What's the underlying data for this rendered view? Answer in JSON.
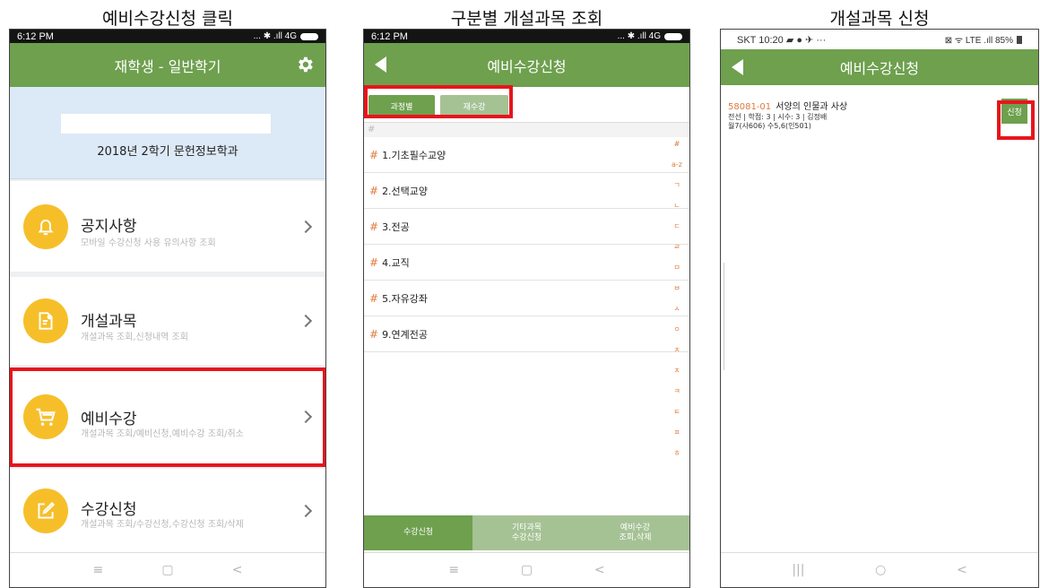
{
  "captions": [
    "예비수강신청 클릭",
    "구분별 개설과목 조회",
    "개설과목 신청"
  ],
  "phone1": {
    "status_time": "6:12 PM",
    "status_icons": "... ✱ .ıll 4G",
    "title": "재학생 - 일반학기",
    "semester": "2018년 2학기  문헌정보학과",
    "menu": [
      {
        "title": "공지사항",
        "subtitle": "모바일 수강신청 사용 유의사항 조회"
      },
      {
        "title": "개설과목",
        "subtitle": "개설과목 조회,신청내역 조회"
      },
      {
        "title": "예비수강",
        "subtitle": "개설과목 조회/예비신청,예비수강 조회/취소"
      },
      {
        "title": "수강신청",
        "subtitle": "개설과목 조회/수강신청,수강신청 조회/삭제"
      }
    ],
    "nav": [
      "≡",
      "▢",
      "<"
    ]
  },
  "phone2": {
    "status_time": "6:12 PM",
    "status_icons": "... ✱ .ıll 4G",
    "title": "예비수강신청",
    "tabs": [
      "과정별",
      "재수강"
    ],
    "list_header": "#",
    "categories": [
      "1.기초필수교양",
      "2.선택교양",
      "3.전공",
      "4.교직",
      "5.자유강좌",
      "9.연계전공"
    ],
    "index": [
      "#",
      "a-z",
      "ㄱ",
      "ㄴ",
      "ㄷ",
      "ㄹ",
      "ㅁ",
      "ㅂ",
      "ㅅ",
      "ㅇ",
      "ㅈ",
      "ㅊ",
      "ㅋ",
      "ㅌ",
      "ㅍ",
      "ㅎ"
    ],
    "bottom_tabs": [
      "수강신청",
      "기타과목\n수강신청",
      "예비수강\n조회,삭제"
    ],
    "nav": [
      "≡",
      "▢",
      "<"
    ]
  },
  "phone3": {
    "status_left": "SKT 10:20 ▰ ● ✈ ···",
    "status_right": "⊠ ᯤ LTE .ıll 85%",
    "title": "예비수강신청",
    "course": {
      "id": "58081-01",
      "name": "서양의 인물과 사상",
      "meta1": "전선 | 학점: 3 | 시수: 3 | 김정배",
      "meta2": "월7(사606) 수5,6(인501)"
    },
    "apply_label": "신청",
    "nav": [
      "|||",
      "○",
      "<"
    ]
  },
  "colors": {
    "accent": "#6ea04e",
    "highlight": "#e8141c",
    "icon_bg": "#f6bf2a",
    "code": "#e07a3e"
  }
}
